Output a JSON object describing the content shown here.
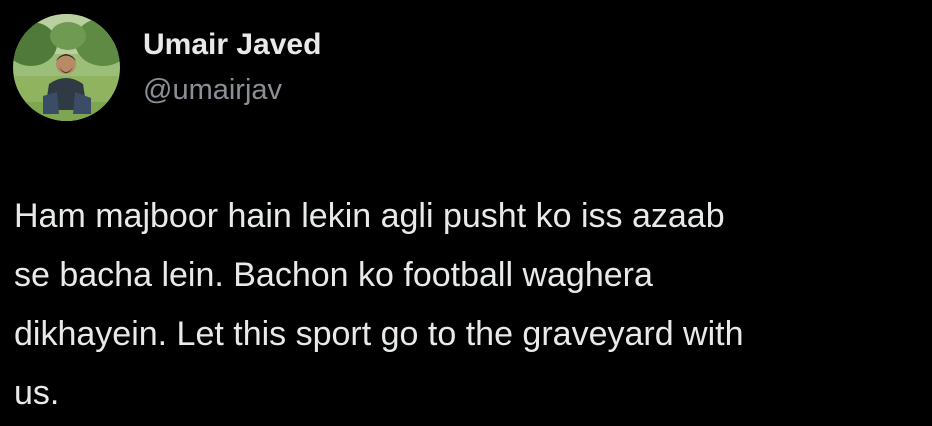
{
  "author": {
    "display_name": "Umair Javed",
    "handle": "@umairjav",
    "avatar_icon": "profile-photo-avatar"
  },
  "tweet": {
    "text": "Ham majboor hain lekin agli pusht ko iss azaab\nse bacha lein. Bachon ko football waghera\ndikhayein. Let this sport go to the graveyard with\nus."
  },
  "colors": {
    "background": "#000000",
    "primary_text": "#e7e9ea",
    "secondary_text": "#8b9096"
  }
}
